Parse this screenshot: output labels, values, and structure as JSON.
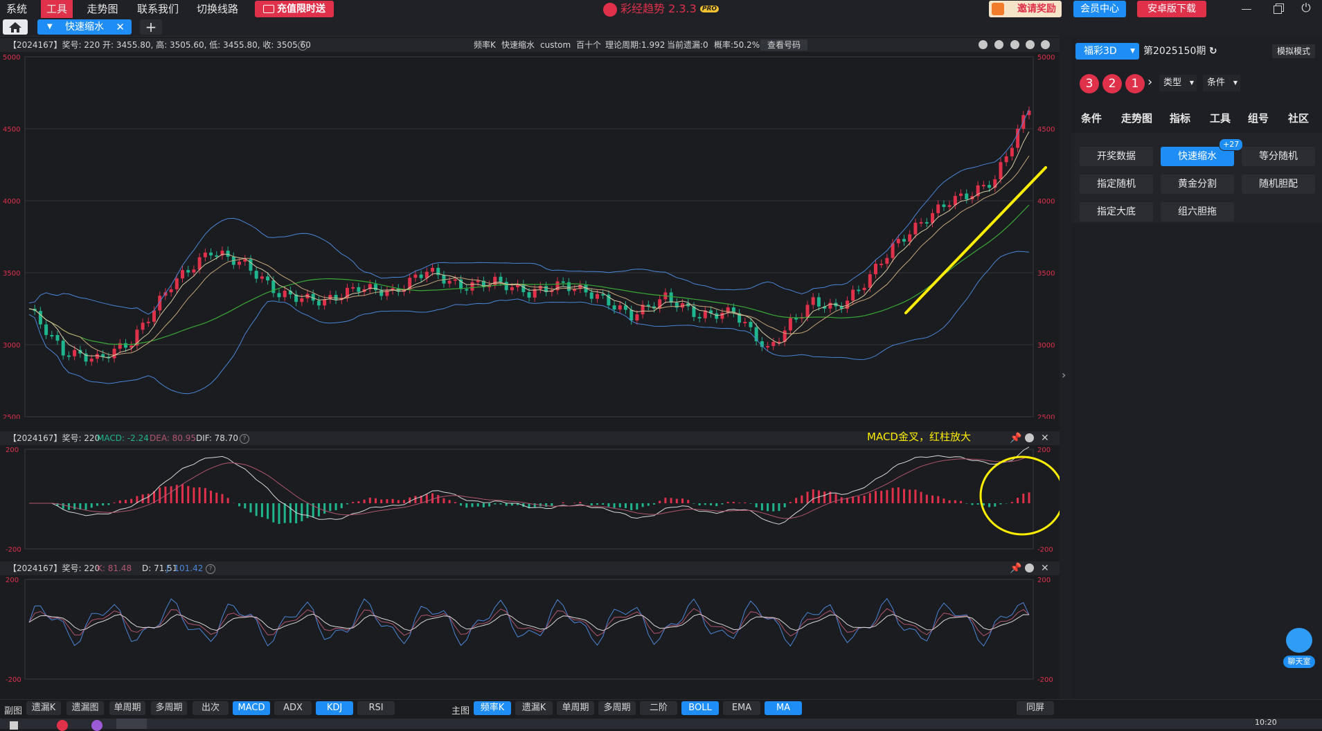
{
  "menu": {
    "items": [
      "系统",
      "工具",
      "走势图",
      "联系我们",
      "切换线路"
    ],
    "active": "工具",
    "promo": "充值限时送"
  },
  "app": {
    "title": "彩经趋势 2.3.3",
    "badge": "PRO"
  },
  "header_buttons": {
    "invite": "邀请奖励",
    "member": "会员中心",
    "android": "安卓版下载"
  },
  "tab": {
    "name": "快速缩水",
    "add": "+"
  },
  "main_chart": {
    "info": "【2024167】奖号: 220  开: 3455.80, 高: 3505.60, 低: 3455.80, 收: 3505.60",
    "tags": [
      "频率K",
      "快速缩水",
      "custom",
      "百十个",
      "理论周期:1.992",
      "当前遗漏:0",
      "概率:50.2%"
    ],
    "query": "查看号码",
    "y_ticks": [
      "5000",
      "4500",
      "4000",
      "3500",
      "3000",
      "2500"
    ]
  },
  "macd": {
    "prefix": "【2024167】奖号: 220",
    "macd": "MACD: -2.24",
    "dea": "DEA: 80.95",
    "dif": "DIF: 78.70",
    "annotation": "MACD金叉，红柱放大",
    "y_ticks": [
      "200",
      "-200"
    ]
  },
  "kdj": {
    "prefix": "【2024167】奖号: 220",
    "k": "K: 81.48",
    "d": "D: 71.51",
    "j": "J: 101.42",
    "y_ticks": [
      "200",
      "-200"
    ]
  },
  "right": {
    "lottery": "福彩3D",
    "period": "第2025150期",
    "mode": "模拟模式",
    "balls": [
      "3",
      "2",
      "1"
    ],
    "type_label": "类型",
    "cond_label": "条件",
    "categories": [
      "条件",
      "走势图",
      "指标",
      "工具",
      "组号",
      "社区"
    ],
    "tools": [
      "开奖数据",
      "快速缩水",
      "等分随机",
      "指定随机",
      "黄金分割",
      "随机胆配",
      "指定大底",
      "组六胆拖"
    ],
    "badge": "+27",
    "chat": "聊天室"
  },
  "bottom_left": {
    "label": "副图",
    "buttons": [
      "遗漏K",
      "遗漏图",
      "单周期",
      "多周期",
      "出次",
      "MACD",
      "ADX",
      "KDJ",
      "RSI"
    ],
    "active": [
      "MACD",
      "KDJ"
    ]
  },
  "bottom_right": {
    "label": "主图",
    "buttons": [
      "频率K",
      "遗漏K",
      "单周期",
      "多周期",
      "二阶",
      "BOLL",
      "EMA",
      "MA"
    ],
    "active": [
      "频率K",
      "BOLL",
      "MA"
    ]
  },
  "sync": "同屏",
  "clock": "10:20",
  "colors": {
    "up": "#e0314b",
    "down": "#1fb58f",
    "accent": "#1e8ef6",
    "annotation": "#ffee00",
    "boll": "#4a86d8",
    "ma_slow": "#3aa836",
    "ma_fast": "#d6c9a0"
  }
}
